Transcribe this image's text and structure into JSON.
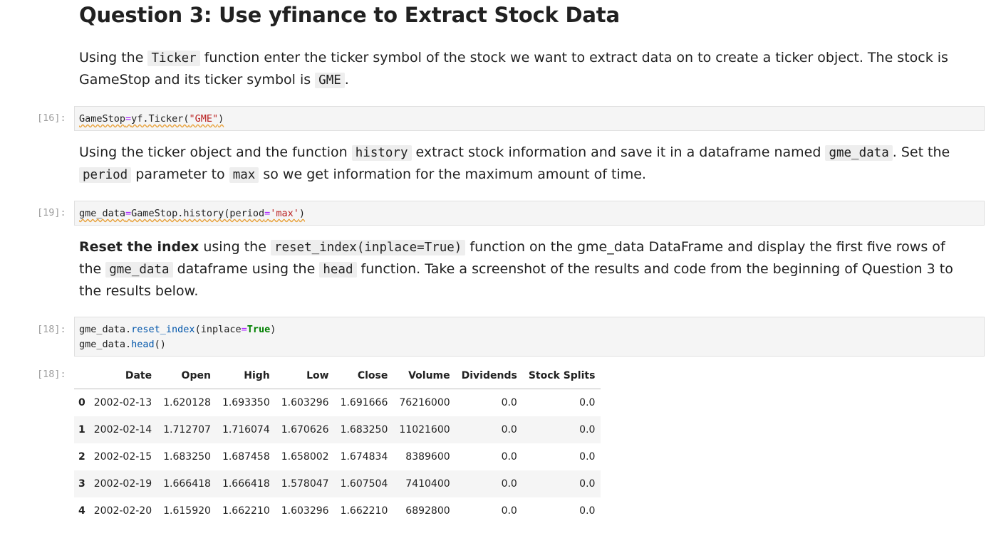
{
  "heading": "Question 3: Use yfinance to Extract Stock Data",
  "para1": {
    "t1": "Using the ",
    "c1": "Ticker",
    "t2": " function enter the ticker symbol of the stock we want to extract data on to create a ticker object. The stock is GameStop and its ticker symbol is ",
    "c2": "GME",
    "t3": "."
  },
  "cell16": {
    "prompt": "[16]:",
    "a": "GameStop",
    "eq": "=",
    "b": "yf.Ticker(",
    "s": "\"GME\"",
    "c": ")"
  },
  "para2": {
    "t1": "Using the ticker object and the function ",
    "c1": "history",
    "t2": " extract stock information and save it in a dataframe named ",
    "c2": "gme_data",
    "t3": ". Set the ",
    "c3": "period",
    "t4": " parameter to ",
    "c4": "max",
    "t5": " so we get information for the maximum amount of time."
  },
  "cell19": {
    "prompt": "[19]:",
    "a": "gme_data",
    "eq": "=",
    "b": "GameStop.history(period",
    "eq2": "=",
    "s": "'max'",
    "c": ")"
  },
  "para3": {
    "bold": "Reset the index",
    "t1": " using the ",
    "c1": "reset_index(inplace=True)",
    "t2": " function on the gme_data DataFrame and display the first five rows of the ",
    "c2": "gme_data",
    "t3": " dataframe using the ",
    "c3": "head",
    "t4": " function. Take a screenshot of the results and code from the beginning of Question 3 to the results below."
  },
  "cell18": {
    "prompt": "[18]:",
    "l1a": "gme_data.",
    "l1fn": "reset_index",
    "l1b": "(inplace",
    "l1eq": "=",
    "l1kw": "True",
    "l1c": ")",
    "l2a": "gme_data.",
    "l2fn": "head",
    "l2b": "()"
  },
  "output18": {
    "prompt": "[18]:",
    "columns": [
      "",
      "Date",
      "Open",
      "High",
      "Low",
      "Close",
      "Volume",
      "Dividends",
      "Stock Splits"
    ],
    "rows": [
      [
        "0",
        "2002-02-13",
        "1.620128",
        "1.693350",
        "1.603296",
        "1.691666",
        "76216000",
        "0.0",
        "0.0"
      ],
      [
        "1",
        "2002-02-14",
        "1.712707",
        "1.716074",
        "1.670626",
        "1.683250",
        "11021600",
        "0.0",
        "0.0"
      ],
      [
        "2",
        "2002-02-15",
        "1.683250",
        "1.687458",
        "1.658002",
        "1.674834",
        "8389600",
        "0.0",
        "0.0"
      ],
      [
        "3",
        "2002-02-19",
        "1.666418",
        "1.666418",
        "1.578047",
        "1.607504",
        "7410400",
        "0.0",
        "0.0"
      ],
      [
        "4",
        "2002-02-20",
        "1.615920",
        "1.662210",
        "1.603296",
        "1.662210",
        "6892800",
        "0.0",
        "0.0"
      ]
    ]
  }
}
